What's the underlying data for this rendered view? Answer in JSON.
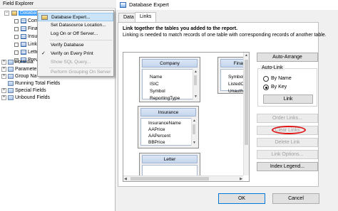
{
  "field_explorer": {
    "title": "Field Explorer",
    "items": [
      {
        "label": "Database",
        "expander": "−"
      },
      {
        "label": "Compa"
      },
      {
        "label": "Finan"
      },
      {
        "label": "Insura"
      },
      {
        "label": "Linkin"
      },
      {
        "label": "Letter"
      },
      {
        "label": "PrevL"
      },
      {
        "label": "Formula",
        "expander": "+"
      },
      {
        "label": "Paramete",
        "expander": "+"
      },
      {
        "label": "Group Na",
        "expander": "+"
      },
      {
        "label": "Running Total Fields"
      },
      {
        "label": "Special Fields",
        "expander": "+"
      },
      {
        "label": "Unbound Fields",
        "expander": "+"
      }
    ]
  },
  "context_menu": {
    "items": [
      {
        "label": "Database Expert...",
        "state": "highlighted"
      },
      {
        "label": "Set Datasource Location..."
      },
      {
        "label": "Log On or Off Server..."
      },
      {
        "label": "Verify Database"
      },
      {
        "label": "Verify on Every Print",
        "checked": "✓"
      },
      {
        "label": "Show SQL Query...",
        "state": "disabled"
      },
      {
        "label": "Perform Grouping On Server",
        "state": "disabled"
      }
    ]
  },
  "dialog": {
    "title": "Database Expert",
    "tabs": [
      {
        "label": "Data"
      },
      {
        "label": "Links"
      }
    ],
    "description_bold": "Link together the tables you added to the report.",
    "description": "Linking is needed to match records of one table with corresponding records of another table.",
    "tables": {
      "company": {
        "name": "Company",
        "fields": [
          "Name",
          "ISIC",
          "Symbol",
          "ReportingType"
        ]
      },
      "financial": {
        "name": "Finar",
        "fields": [
          "Symbol",
          "ListedCap",
          "Unauthor"
        ]
      },
      "insurance": {
        "name": "Insurance",
        "fields": [
          "InsuranceName",
          "AAPrice",
          "AAPercent",
          "BBPrice"
        ]
      },
      "letter": {
        "name": "Letter",
        "fields": []
      }
    },
    "buttons": {
      "auto_arrange": "Auto-Arrange",
      "link": "Link",
      "order_links": "Order Links...",
      "clear_links": "Clear Links",
      "delete_link": "Delete Link",
      "link_options": "Link Options...",
      "index_legend": "Index Legend...",
      "ok": "OK",
      "cancel": "Cancel"
    },
    "auto_link": {
      "label": "Auto-Link",
      "options": [
        {
          "label": "By Name",
          "selected": false
        },
        {
          "label": "By Key",
          "selected": true
        }
      ]
    },
    "highlight_color": "#e01515"
  }
}
